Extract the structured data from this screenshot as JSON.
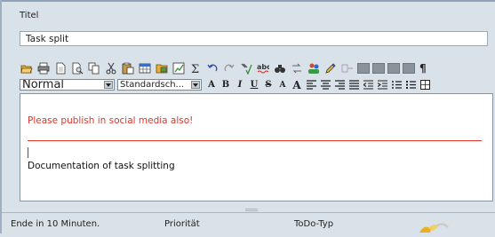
{
  "title_label": "Titel",
  "title_value": "Task split",
  "toolbar": {
    "style_select": "Normal",
    "font_select": "Standardsch..."
  },
  "editor": {
    "highlight_text": "Please publish in social media also!",
    "body_text": "Documentation of task splitting"
  },
  "status": {
    "reminder": "Ende in 10 Minuten.",
    "priority_label": "Priorität",
    "type_label": "ToDo-Typ"
  },
  "colors": {
    "background": "#d9e1e9",
    "highlight_red": "#e5332a"
  }
}
